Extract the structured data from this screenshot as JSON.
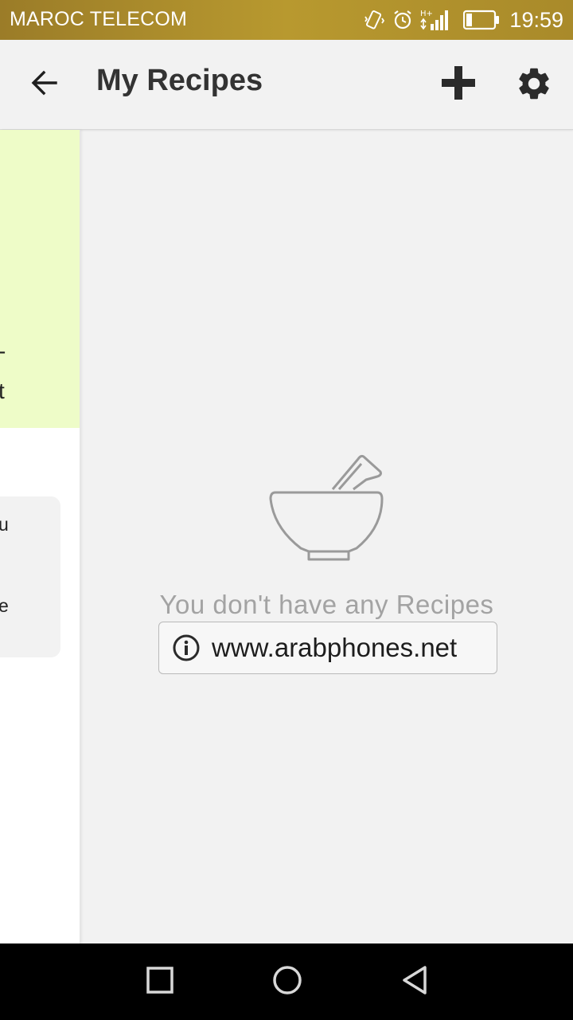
{
  "status_bar": {
    "carrier": "MAROC TELECOM",
    "time": "19:59",
    "icons": [
      "vibrate-icon",
      "alarm-icon",
      "network-hplus-icon",
      "signal-icon",
      "battery-icon"
    ],
    "network_type": "H+"
  },
  "app_bar": {
    "title": "My Recipes",
    "back_icon": "arrow-left-icon",
    "add_icon": "plus-icon",
    "settings_icon": "gear-icon"
  },
  "drawer": {
    "green_card_fragments": [
      "-",
      "t"
    ],
    "gray_card_fragments": [
      "u",
      "e"
    ]
  },
  "empty_state": {
    "icon": "mortar-pestle-icon",
    "message": "You don't have any Recipes"
  },
  "watermark": {
    "icon": "info-icon",
    "text": "www.arabphones.net"
  },
  "nav_bar": {
    "icons": [
      "recents-square-icon",
      "home-circle-icon",
      "back-triangle-icon"
    ]
  },
  "colors": {
    "status_bar": "#a98a2a",
    "app_bar": "#f2f2f2",
    "drawer_green_card": "#eefcc8",
    "empty_text": "#a3a3a3",
    "title_text": "#333333"
  }
}
